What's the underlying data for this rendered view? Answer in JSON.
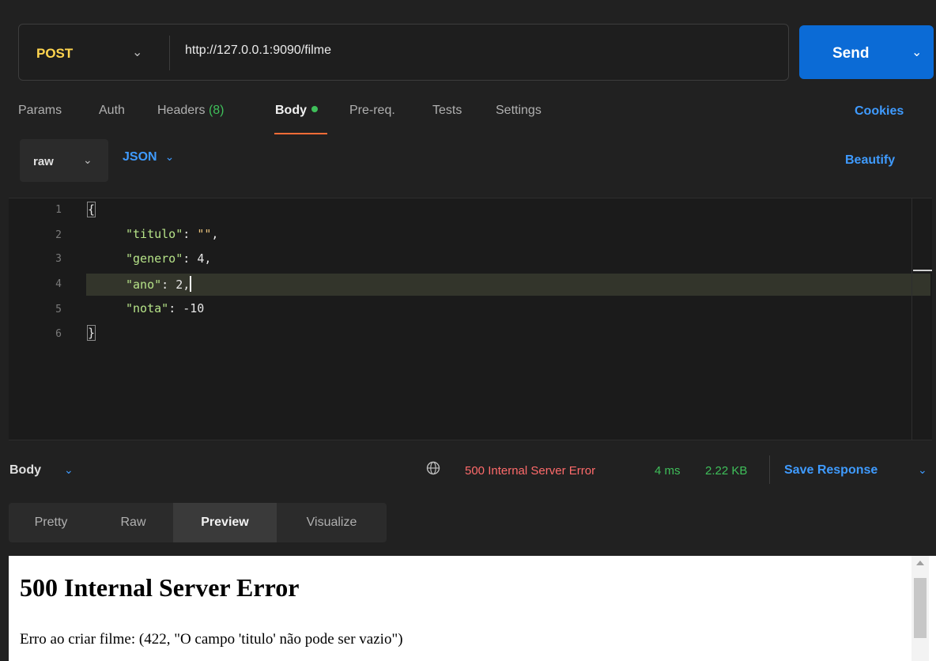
{
  "request": {
    "method": "POST",
    "url": "http://127.0.0.1:9090/filme",
    "send_label": "Send"
  },
  "tabs": [
    {
      "label": "Params"
    },
    {
      "label": "Auth"
    },
    {
      "label": "Headers",
      "count": "(8)"
    },
    {
      "label": "Body",
      "active": true
    },
    {
      "label": "Pre-req."
    },
    {
      "label": "Tests"
    },
    {
      "label": "Settings"
    }
  ],
  "cookies_label": "Cookies",
  "body_options": {
    "mode": "raw",
    "format": "JSON",
    "beautify_label": "Beautify"
  },
  "editor": {
    "line_numbers": [
      "1",
      "2",
      "3",
      "4",
      "5",
      "6"
    ],
    "open_brace": "{",
    "close_brace": "}",
    "fields": [
      {
        "key": "\"titulo\"",
        "sep": ": ",
        "value": "\"\"",
        "comma": ","
      },
      {
        "key": "\"genero\"",
        "sep": ": ",
        "value": "4",
        "comma": ","
      },
      {
        "key": "\"ano\"",
        "sep": ": ",
        "value": "2",
        "comma": ","
      },
      {
        "key": "\"nota\"",
        "sep": ": ",
        "value": "-10",
        "comma": ""
      }
    ]
  },
  "response": {
    "body_label": "Body",
    "status": "500 Internal Server Error",
    "time": "4 ms",
    "size": "2.22 KB",
    "save_label": "Save Response"
  },
  "view_tabs": [
    {
      "label": "Pretty"
    },
    {
      "label": "Raw"
    },
    {
      "label": "Preview",
      "active": true
    },
    {
      "label": "Visualize"
    }
  ],
  "preview": {
    "title": "500 Internal Server Error",
    "message": "Erro ao criar filme: (422, \"O campo 'titulo' não pode ser vazio\")"
  },
  "colors": {
    "method": "#ffd54f",
    "send": "#0b6bd6",
    "accent_blue": "#3f9bff",
    "success_green": "#3fbf5a",
    "error_red": "#ff6b6b",
    "active_tab_underline": "#ff6c37"
  },
  "icons": [
    "chevron-down-icon",
    "globe-icon",
    "status-dot-icon"
  ]
}
